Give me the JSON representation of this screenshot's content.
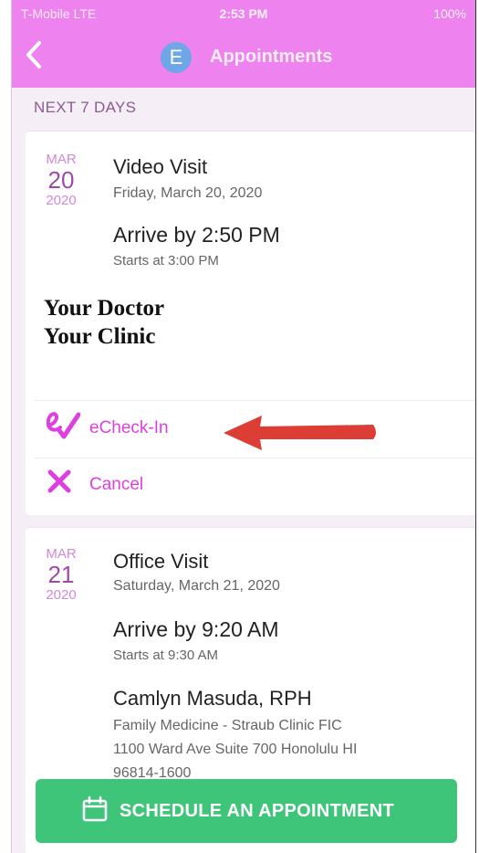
{
  "status": {
    "carrier": "T-Mobile  LTE",
    "time": "2:53 PM",
    "battery": "100%"
  },
  "nav": {
    "back_icon": "chevron-left-icon",
    "avatar_letter": "E",
    "title": "Appointments"
  },
  "section_label": "NEXT 7 DAYS",
  "appointments": [
    {
      "month": "MAR",
      "day": "20",
      "year": "2020",
      "type": "Video Visit",
      "date_full": "Friday, March 20, 2020",
      "arrive": "Arrive by 2:50 PM",
      "starts": "Starts at 3:00 PM",
      "doctor": "Your Doctor",
      "clinic": "Your Clinic",
      "actions": [
        {
          "icon": "echeckin-icon",
          "label": "eCheck-In"
        },
        {
          "icon": "close-icon",
          "label": "Cancel"
        }
      ]
    },
    {
      "month": "MAR",
      "day": "21",
      "year": "2020",
      "type": "Office Visit",
      "date_full": "Saturday, March 21, 2020",
      "arrive": "Arrive by 9:20 AM",
      "starts": "Starts at 9:30 AM",
      "provider": "Camlyn Masuda, RPH",
      "department": "Family Medicine - Straub Clinic FIC",
      "address1": "1100 Ward Ave Suite 700 Honolulu HI",
      "address2": "96814-1600"
    }
  ],
  "schedule_button": {
    "icon": "calendar-icon",
    "label": "SCHEDULE AN APPOINTMENT"
  },
  "colors": {
    "header": "#ee82ee",
    "accent": "#e03fe0",
    "button": "#3fc57a",
    "arrow": "#dc3e36"
  }
}
